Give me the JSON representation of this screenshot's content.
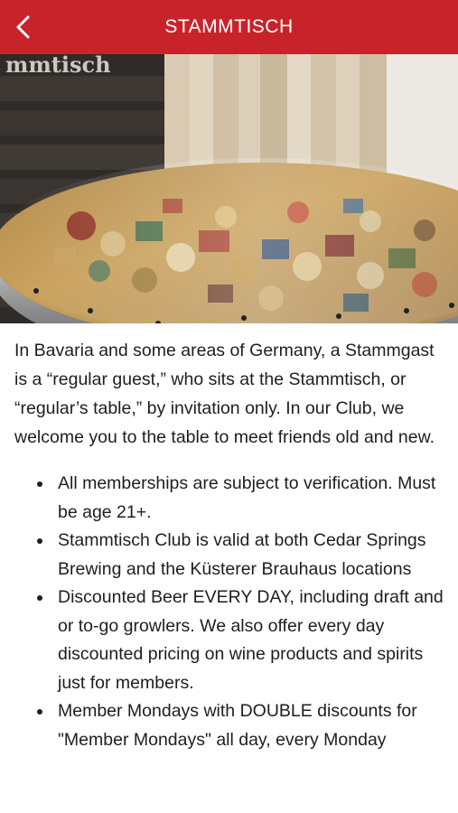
{
  "header": {
    "title": "STAMMTISCH",
    "back_icon": "chevron-left-icon",
    "background": "#c8232b"
  },
  "hero": {
    "image_description_icon": "photo"
  },
  "content": {
    "intro": "In Bavaria and some areas of Germany, a Stammgast is a “regular guest,” who sits at the Stammtisch, or “regular’s table,” by invitation only. In our Club, we welcome you to the table to meet friends old and new.",
    "bullets": [
      "All memberships are subject to verification. Must be age 21+.",
      "Stammtisch Club is valid at both Cedar Springs Brewing and the Küsterer Brauhaus locations",
      "Discounted Beer EVERY DAY, including draft and or to-go growlers. We also offer every day discounted pricing on wine products and spirits just for members.",
      "Member Mondays with DOUBLE discounts for \"Member Mondays\" all day, every Monday"
    ]
  }
}
